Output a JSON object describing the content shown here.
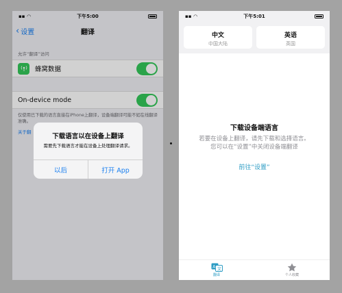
{
  "left": {
    "status": {
      "time": "下午5:00"
    },
    "nav": {
      "back": "设置",
      "title": "翻译"
    },
    "section_header": "允许“翻译”访问",
    "cellular": {
      "label": "蜂窝数据",
      "on": true
    },
    "on_device": {
      "label": "On-device mode",
      "on": true
    },
    "description": "仅使用已下载的语言直接在iPhone上翻译，设备端翻译可能不如在线翻译准确。",
    "link_prefix": "关于翻",
    "alert": {
      "title": "下载语言以在设备上翻译",
      "message": "需要先下载语言才能在设备上处理翻译请求。",
      "later": "以后",
      "open": "打开 App"
    }
  },
  "right": {
    "status": {
      "time": "下午5:01"
    },
    "source": {
      "lang": "中文",
      "region": "中国大陆"
    },
    "target": {
      "lang": "英语",
      "region": "英国"
    },
    "title": "下载设备端语言",
    "msg1": "若要在设备上翻译，请先下载和选择语言。",
    "msg2": "您可以在“设置”中关闭设备端翻译",
    "go": "前往“设置”",
    "tabs": [
      {
        "label": "翻译",
        "icon": "translate-icon",
        "active": true
      },
      {
        "label": "个人收藏",
        "icon": "star-icon",
        "active": false
      }
    ]
  },
  "colors": {
    "accent": "#1a7ff0",
    "toggle": "#34c759",
    "teal": "#2d9cc4"
  }
}
